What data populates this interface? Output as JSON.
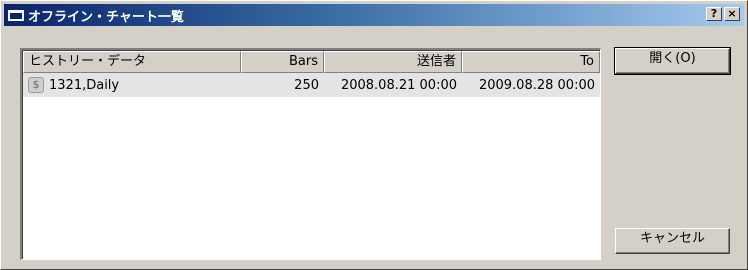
{
  "window": {
    "title": "オフライン・チャート一覧",
    "help_button": "?",
    "close_button": "×"
  },
  "list": {
    "columns": [
      "ヒストリー・データ",
      "Bars",
      "送信者",
      "To"
    ],
    "rows": [
      {
        "icon": "dollar-icon",
        "icon_glyph": "$",
        "name": "1321,Daily",
        "bars": "250",
        "from": "2008.08.21 00:00",
        "to": "2009.08.28 00:00"
      }
    ]
  },
  "buttons": {
    "open": "開く(O)",
    "cancel": "キャンセル"
  },
  "colors": {
    "title_gradient_start": "#0a246a",
    "title_gradient_end": "#a6caf0",
    "dialog_face": "#d4d0c8",
    "row_highlight": "#e4e4e4"
  }
}
